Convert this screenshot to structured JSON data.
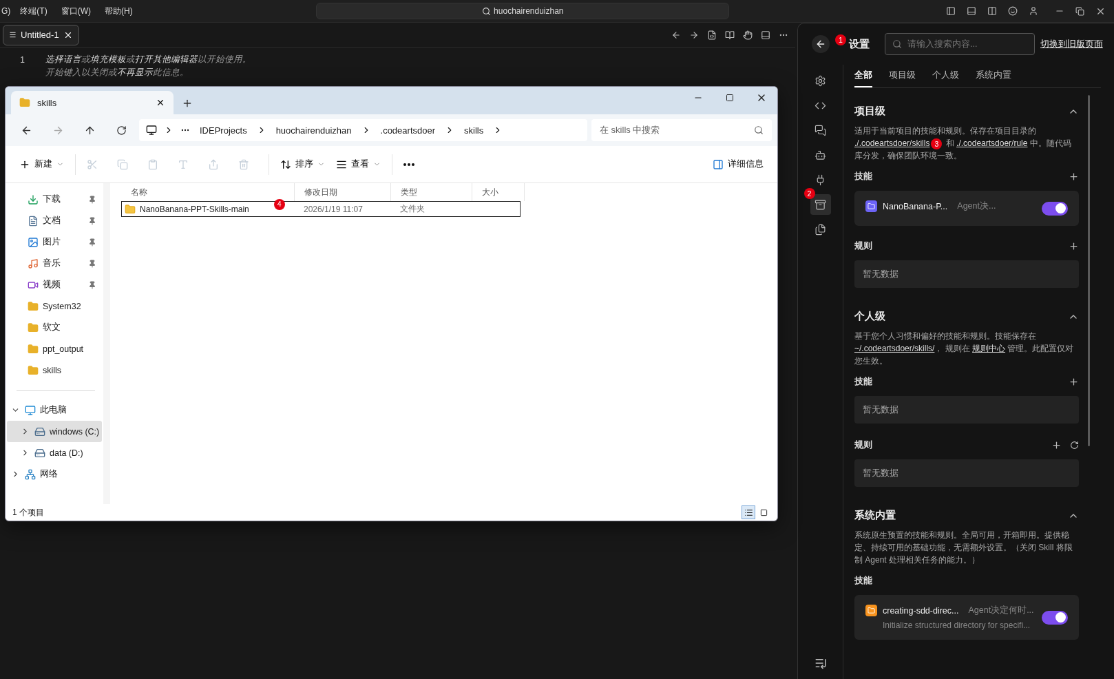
{
  "menubar": {
    "items": [
      "G)",
      "终端(T)",
      "窗口(W)",
      "帮助(H)"
    ],
    "search": "huochairenduizhan"
  },
  "editor": {
    "tabs": [
      {
        "title": "Untitled-1",
        "selected": true
      }
    ],
    "line_number": "1",
    "hint": "**选择语言**或**填充模板**或**打开其他编辑器**以开始使用。",
    "hint_2": "开始键入以关闭或**不再显示**此信息。"
  },
  "explorer": {
    "tabs": [
      {
        "title": "skills",
        "selected": true
      }
    ],
    "breadcrumb": [
      "IDEProjects",
      "huochairenduizhan",
      ".codeartsdoer",
      "skills"
    ],
    "search": {
      "placeholder": "在 skills 中搜索"
    },
    "toolbar": [
      {
        "kind": "new",
        "label": "新建",
        "disabled": false
      },
      {
        "kind": "cut",
        "disabled": true
      },
      {
        "kind": "copy",
        "disabled": true
      },
      {
        "kind": "paste",
        "disabled": true
      },
      {
        "kind": "rename",
        "disabled": true
      },
      {
        "kind": "share",
        "disabled": true
      },
      {
        "kind": "delete",
        "disabled": true
      },
      {
        "kind": "sort",
        "label": "排序",
        "disabled": false
      },
      {
        "kind": "view",
        "label": "查看",
        "disabled": false
      },
      {
        "kind": "more",
        "disabled": false
      }
    ],
    "details": "详细信息",
    "quick_access": [
      {
        "label": "下载",
        "kind": "download",
        "pinned": true
      },
      {
        "label": "文档",
        "kind": "document",
        "pinned": true
      },
      {
        "label": "图片",
        "kind": "pictures",
        "pinned": true
      },
      {
        "label": "音乐",
        "kind": "music",
        "pinned": true
      },
      {
        "label": "视频",
        "kind": "video",
        "pinned": true
      },
      {
        "label": "System32",
        "kind": "folder",
        "pinned": false
      },
      {
        "label": "软文",
        "kind": "folder",
        "pinned": false
      },
      {
        "label": "ppt_output",
        "kind": "folder",
        "pinned": false
      },
      {
        "label": "skills",
        "kind": "folder",
        "pinned": false
      }
    ],
    "tree": [
      {
        "label": "此电脑",
        "kind": "pc",
        "expanded": true,
        "selected": false,
        "children": [
          {
            "label": "windows (C:)",
            "kind": "drive",
            "expanded": false,
            "selected": true
          },
          {
            "label": "data (D:)",
            "kind": "drive",
            "expanded": false,
            "selected": false
          }
        ]
      },
      {
        "label": "网络",
        "kind": "network",
        "expanded": false,
        "selected": false
      }
    ],
    "columns": [
      "名称",
      "修改日期",
      "类型",
      "大小"
    ],
    "rows": [
      {
        "name": "NanoBanana-PPT-Skills-main",
        "badge": "4",
        "date": "2026/1/19 11:07",
        "type": "文件夹",
        "selected": true
      }
    ],
    "status": "1 个项目"
  },
  "settings": {
    "title": "设置",
    "badge": "1",
    "search": {
      "placeholder": "请输入搜索内容..."
    },
    "switch_link": "切换到旧版页面",
    "rail": [
      {
        "kind": "settings",
        "selected": false
      },
      {
        "kind": "code",
        "selected": false
      },
      {
        "kind": "chat",
        "selected": false
      },
      {
        "kind": "bot",
        "selected": false
      },
      {
        "kind": "mcp",
        "selected": false
      },
      {
        "kind": "skills",
        "selected": true,
        "badge": "2"
      },
      {
        "kind": "docs",
        "selected": false
      }
    ],
    "tabs": [
      {
        "label": "全部",
        "selected": true
      },
      {
        "label": "项目级",
        "selected": false
      },
      {
        "label": "个人级",
        "selected": false
      },
      {
        "label": "系统内置",
        "selected": false
      }
    ],
    "sections": [
      {
        "title": "项目级",
        "expanded": true,
        "description": [
          {
            "kind": "text",
            "text": "适用于当前项目的技能和规则。保存在项目目录的 "
          },
          {
            "kind": "link",
            "text": "./.codeartsdoer/skills",
            "badge": "3"
          },
          {
            "kind": "text",
            "text": " 和 "
          },
          {
            "kind": "link",
            "text": "./.codeartsdoer/rule"
          },
          {
            "kind": "text",
            "text": " 中。随代码库分发，确保团队环境一致。"
          }
        ],
        "groups": [
          {
            "title": "技能",
            "actions": [
              {
                "kind": "add"
              }
            ],
            "items": [
              {
                "name": "NanoBanana-P...",
                "trigger": "Agent决...",
                "on": true,
                "color": "#6c63f5"
              }
            ]
          },
          {
            "title": "规则",
            "actions": [
              {
                "kind": "add"
              }
            ],
            "empty": "暂无数据"
          }
        ]
      },
      {
        "title": "个人级",
        "expanded": true,
        "description": [
          {
            "kind": "text",
            "text": "基于您个人习惯和偏好的技能和规则。技能保存在 "
          },
          {
            "kind": "link",
            "text": "~/.codeartsdoer/skills/"
          },
          {
            "kind": "text",
            "text": "， 规则在 "
          },
          {
            "kind": "link",
            "text": "规则中心"
          },
          {
            "kind": "text",
            "text": " 管理。此配置仅对您生效。"
          }
        ],
        "groups": [
          {
            "title": "技能",
            "actions": [
              {
                "kind": "add"
              }
            ],
            "empty": "暂无数据"
          },
          {
            "title": "规则",
            "actions": [
              {
                "kind": "add"
              },
              {
                "kind": "refresh"
              }
            ],
            "empty": "暂无数据"
          }
        ]
      },
      {
        "title": "系统内置",
        "expanded": true,
        "description": [
          {
            "kind": "text",
            "text": "系统原生预置的技能和规则。全局可用，开箱即用。提供稳定、持续可用的基础功能，无需额外设置。（关闭 Skill 将限制 Agent 处理相关任务的能力。）"
          }
        ],
        "groups": [
          {
            "title": "技能",
            "items": [
              {
                "name": "creating-sdd-direc...",
                "trigger": "Agent决定何时...",
                "description": "Initialize structured directory for specifi...",
                "on": true,
                "color": "#f7931e"
              }
            ]
          }
        ]
      }
    ]
  }
}
